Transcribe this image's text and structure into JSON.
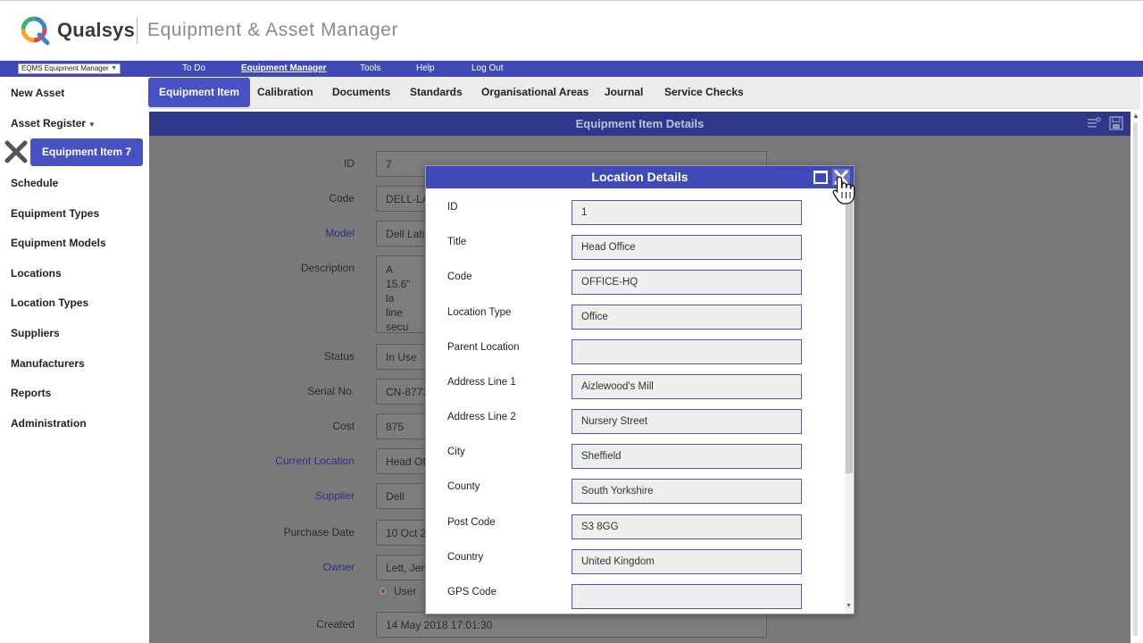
{
  "header": {
    "brand": "Qualsys",
    "app_title": "Equipment & Asset Manager"
  },
  "menubar": {
    "app_selector": "EQMS Equipment Manager",
    "items": [
      {
        "label": "To Do"
      },
      {
        "label": "Equipment Manager",
        "active": true
      },
      {
        "label": "Tools"
      },
      {
        "label": "Help"
      },
      {
        "label": "Log Out"
      }
    ]
  },
  "sidebar": {
    "new_asset": "New Asset",
    "asset_register": "Asset Register",
    "active_item": "Equipment Item 7",
    "items": [
      {
        "label": "Schedule"
      },
      {
        "label": "Equipment Types"
      },
      {
        "label": "Equipment Models"
      },
      {
        "label": "Locations"
      },
      {
        "label": "Location Types"
      },
      {
        "label": "Suppliers"
      },
      {
        "label": "Manufacturers"
      },
      {
        "label": "Reports"
      },
      {
        "label": "Administration"
      }
    ]
  },
  "tabs": [
    {
      "label": "Equipment Item",
      "active": true
    },
    {
      "label": "Calibration"
    },
    {
      "label": "Documents"
    },
    {
      "label": "Standards"
    },
    {
      "label": "Organisational Areas"
    },
    {
      "label": "Journal"
    },
    {
      "label": "Service Checks"
    }
  ],
  "main": {
    "title": "Equipment Item Details",
    "fields": [
      {
        "label": "ID",
        "value": "7"
      },
      {
        "label": "Code",
        "value": "DELL-LA"
      },
      {
        "label": "Model",
        "value": "Dell Lati",
        "link": true
      },
      {
        "label": "Description",
        "value_line1": "A 15.6\" la",
        "value_line2": "line secu"
      },
      {
        "label": "Status",
        "value": "In Use"
      },
      {
        "label": "Serial No.",
        "value": "CN-8773"
      },
      {
        "label": "Cost",
        "value": "875"
      },
      {
        "label": "Current Location",
        "value": "Head Of",
        "link": true
      },
      {
        "label": "Supplier",
        "value": "Dell",
        "link": true
      },
      {
        "label": "Purchase Date",
        "value": "10 Oct 20"
      },
      {
        "label": "Owner",
        "value": "Lett, Jen",
        "link": true
      },
      {
        "label": "Created",
        "value": "14 May 2018 17:01:30"
      }
    ],
    "owner_radio": "User"
  },
  "modal": {
    "title": "Location Details",
    "fields": [
      {
        "label": "ID",
        "value": "1"
      },
      {
        "label": "Title",
        "value": "Head Office"
      },
      {
        "label": "Code",
        "value": "OFFICE-HQ"
      },
      {
        "label": "Location Type",
        "value": "Office"
      },
      {
        "label": "Parent Location",
        "value": ""
      },
      {
        "label": "Address Line 1",
        "value": "Aizlewood's Mill"
      },
      {
        "label": "Address Line 2",
        "value": "Nursery Street"
      },
      {
        "label": "City",
        "value": "Sheffield"
      },
      {
        "label": "County",
        "value": "South Yorkshire"
      },
      {
        "label": "Post Code",
        "value": "S3 8GG"
      },
      {
        "label": "Country",
        "value": "United Kingdom"
      },
      {
        "label": "GPS Code",
        "value": ""
      }
    ]
  },
  "colors": {
    "accent": "#3f4ab8",
    "accent_dark": "#2e378a",
    "overlay": "#7a7a7a"
  }
}
